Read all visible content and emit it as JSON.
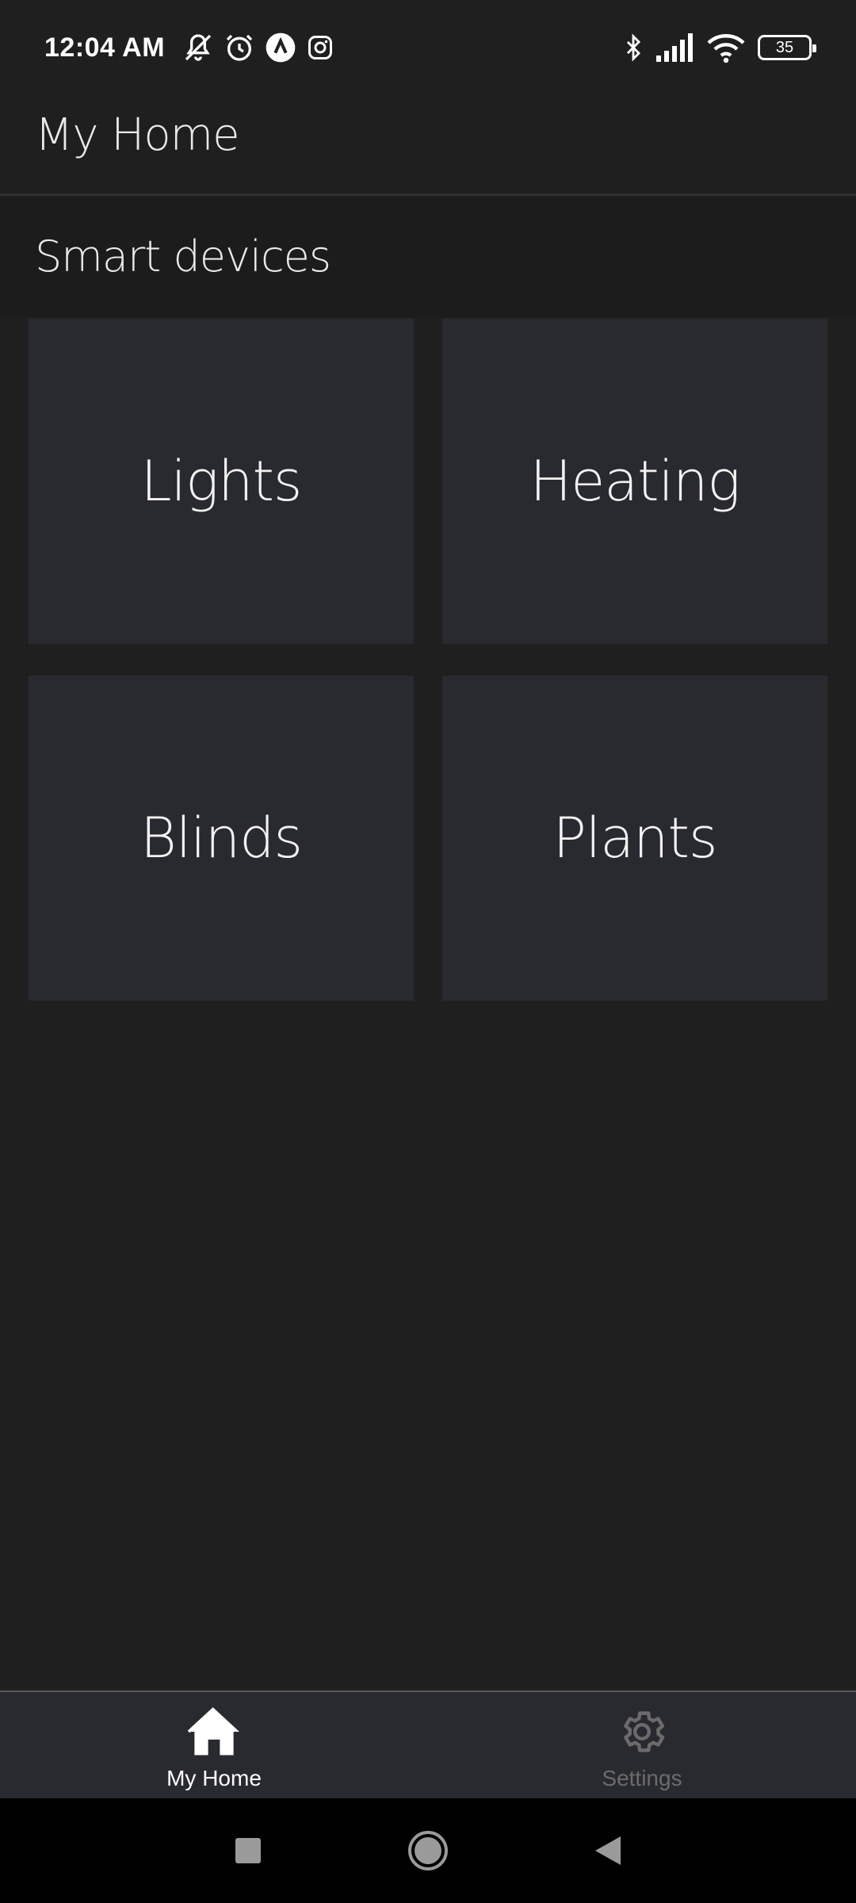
{
  "status_bar": {
    "time": "12:04 AM",
    "battery_level": "35",
    "icons": [
      "muted-bell-icon",
      "alarm-icon",
      "app-notification-icon",
      "instagram-icon",
      "bluetooth-icon",
      "signal-icon",
      "wifi-icon",
      "battery-icon"
    ]
  },
  "header": {
    "title": "My Home"
  },
  "section": {
    "title": "Smart devices"
  },
  "devices": [
    {
      "label": "Lights"
    },
    {
      "label": "Heating"
    },
    {
      "label": "Blinds"
    },
    {
      "label": "Plants"
    }
  ],
  "bottom_nav": {
    "items": [
      {
        "label": "My Home",
        "icon": "home-icon",
        "active": true
      },
      {
        "label": "Settings",
        "icon": "gear-icon",
        "active": false
      }
    ]
  },
  "colors": {
    "background": "#1f1f1f",
    "tile": "#292a2f",
    "nav_bar": "#292a2f",
    "active": "#ffffff",
    "inactive": "#6b6b6b"
  }
}
